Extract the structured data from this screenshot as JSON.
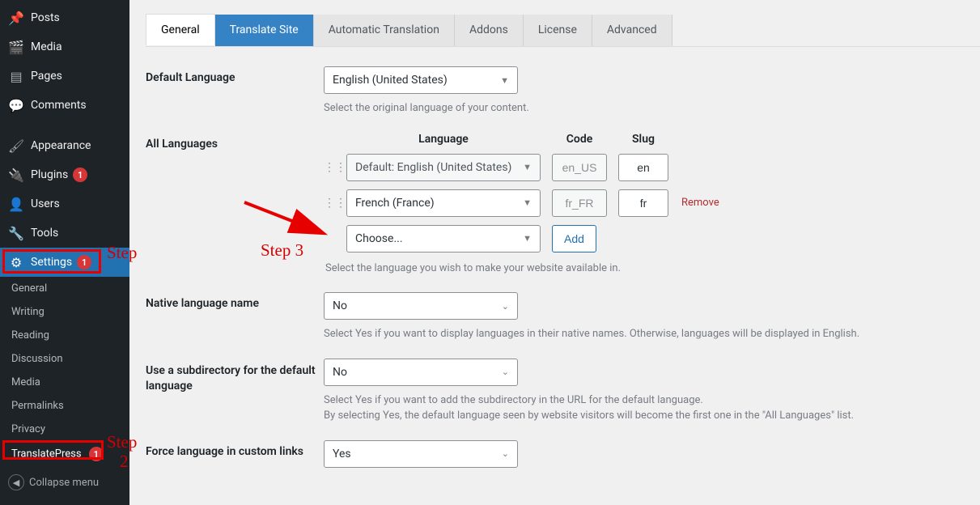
{
  "sidebar": {
    "main": [
      {
        "icon": "📌",
        "label": "Posts"
      },
      {
        "icon": "🎬",
        "label": "Media"
      },
      {
        "icon": "▤",
        "label": "Pages"
      },
      {
        "icon": "💬",
        "label": "Comments"
      }
    ],
    "appearance": {
      "icon": "🖌",
      "label": "Appearance"
    },
    "plugins": {
      "icon": "🔌",
      "label": "Plugins",
      "badge": "1"
    },
    "users": {
      "icon": "👤",
      "label": "Users"
    },
    "tools": {
      "icon": "🔧",
      "label": "Tools"
    },
    "settings": {
      "icon": "⚙",
      "label": "Settings",
      "badge": "1"
    },
    "subs": [
      {
        "label": "General"
      },
      {
        "label": "Writing"
      },
      {
        "label": "Reading"
      },
      {
        "label": "Discussion"
      },
      {
        "label": "Media"
      },
      {
        "label": "Permalinks"
      },
      {
        "label": "Privacy"
      }
    ],
    "translate_sub": {
      "label": "TranslatePress",
      "badge": "1"
    },
    "collapse": "Collapse menu"
  },
  "tabs": [
    {
      "label": "General",
      "state": "white"
    },
    {
      "label": "Translate Site",
      "state": "blue"
    },
    {
      "label": "Automatic Translation",
      "state": ""
    },
    {
      "label": "Addons",
      "state": ""
    },
    {
      "label": "License",
      "state": ""
    },
    {
      "label": "Advanced",
      "state": ""
    }
  ],
  "default_lang": {
    "label": "Default Language",
    "value": "English (United States)",
    "desc": "Select the original language of your content."
  },
  "all_langs": {
    "label": "All Languages",
    "headers": {
      "lang": "Language",
      "code": "Code",
      "slug": "Slug"
    },
    "rows": [
      {
        "lang": "Default: English (United States)",
        "code": "en_US",
        "slug": "en",
        "dim": true,
        "remove": false
      },
      {
        "lang": "French (France)",
        "code": "fr_FR",
        "slug": "fr",
        "dim": false,
        "remove": true
      }
    ],
    "choose": "Choose...",
    "add": "Add",
    "remove": "Remove",
    "desc": "Select the language you wish to make your website available in."
  },
  "native": {
    "label": "Native language name",
    "value": "No",
    "desc": "Select Yes if you want to display languages in their native names. Otherwise, languages will be displayed in English."
  },
  "subdir": {
    "label": "Use a subdirectory for the default language",
    "value": "No",
    "desc1": "Select Yes if you want to add the subdirectory in the URL for the default language.",
    "desc2": "By selecting Yes, the default language seen by website visitors will become the first one in the \"All Languages\" list."
  },
  "force": {
    "label": "Force language in custom links",
    "value": "Yes"
  },
  "annotations": {
    "step": "Step",
    "step3": "Step 3",
    "step2_num": "2"
  }
}
